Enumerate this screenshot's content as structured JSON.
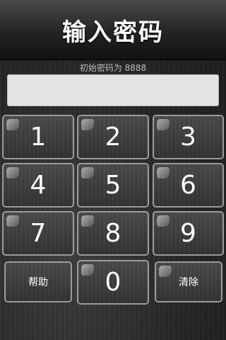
{
  "title": "输入密码",
  "hint": "初始密码为 8888",
  "password_input": {
    "value": "",
    "placeholder": ""
  },
  "keys": {
    "k1": "1",
    "k2": "2",
    "k3": "3",
    "k4": "4",
    "k5": "5",
    "k6": "6",
    "k7": "7",
    "k8": "8",
    "k9": "9",
    "help": "帮助",
    "k0": "0",
    "clear": "清除"
  }
}
